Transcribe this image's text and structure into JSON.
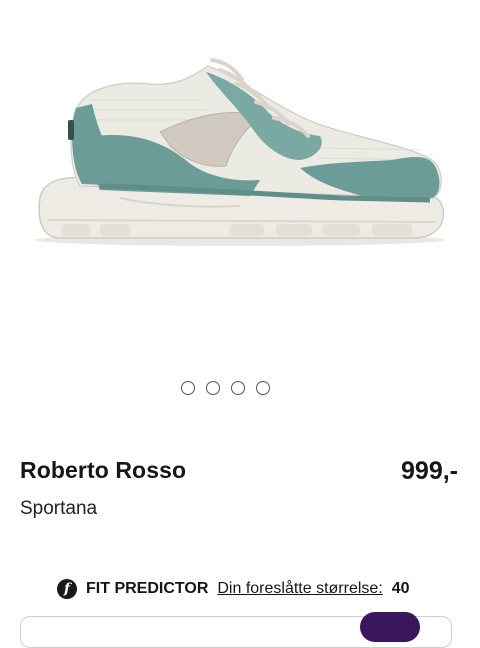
{
  "product": {
    "brand": "Roberto Rosso",
    "model": "Sportana",
    "price": "999,-",
    "image_icon": "sneaker-image",
    "gallery_count": 4,
    "colors": {
      "suede": "#6c9c97",
      "mesh": "#ecebe3",
      "sole": "#edebe4",
      "accent": "#3a175c"
    }
  },
  "fit_predictor": {
    "icon": "fit-predictor-logo-icon",
    "logo_glyph": "f",
    "title": "FIT PREDICTOR",
    "link_label": "Din foreslåtte størrelse:",
    "size": "40"
  }
}
